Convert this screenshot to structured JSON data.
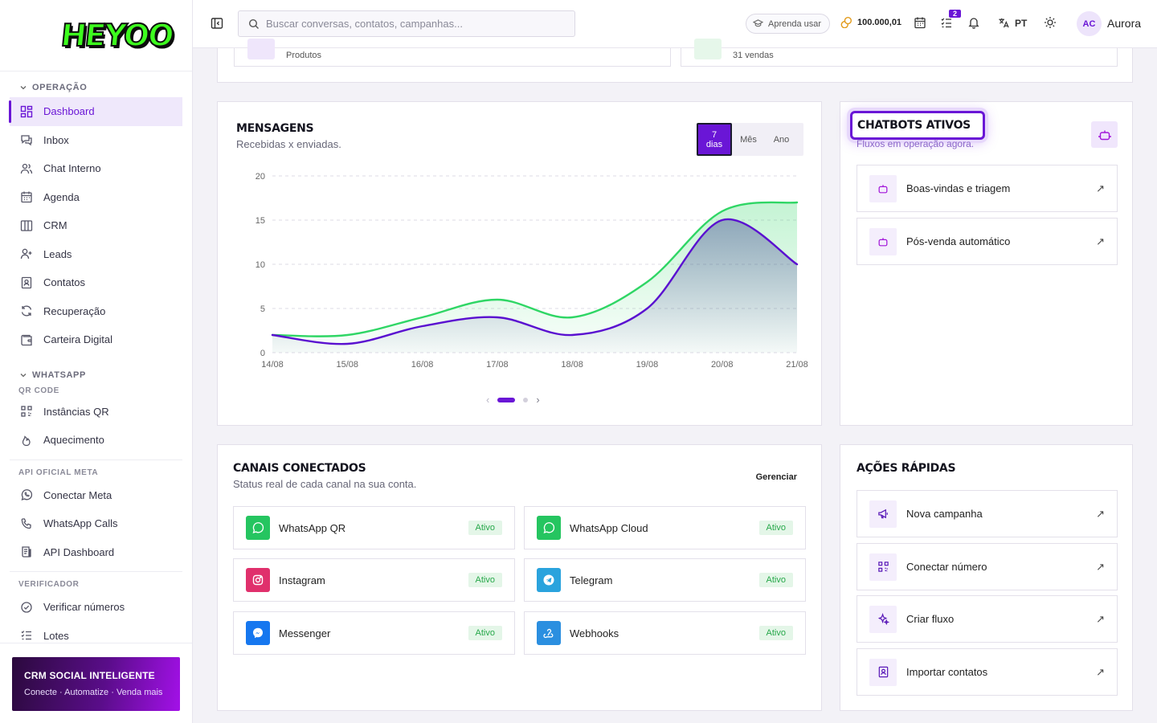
{
  "brand": {
    "logo_text": "HEYOO"
  },
  "sidebar": {
    "section_operacao": "OPERAÇÃO",
    "operacao_items": [
      {
        "label": "Dashboard",
        "icon": "dashboard-icon",
        "active": true
      },
      {
        "label": "Inbox",
        "icon": "inbox-icon"
      },
      {
        "label": "Chat Interno",
        "icon": "users-icon"
      },
      {
        "label": "Agenda",
        "icon": "calendar-icon"
      },
      {
        "label": "CRM",
        "icon": "columns-icon"
      },
      {
        "label": "Leads",
        "icon": "user-plus-icon"
      },
      {
        "label": "Contatos",
        "icon": "contact-book-icon"
      },
      {
        "label": "Recuperação",
        "icon": "refresh-icon"
      },
      {
        "label": "Carteira Digital",
        "icon": "wallet-icon"
      }
    ],
    "section_whatsapp": "WHATSAPP",
    "sub_qr": "QR CODE",
    "qr_items": [
      {
        "label": "Instâncias QR",
        "icon": "qr-icon"
      },
      {
        "label": "Aquecimento",
        "icon": "flame-icon"
      }
    ],
    "sub_meta": "API OFICIAL META",
    "meta_items": [
      {
        "label": "Conectar Meta",
        "icon": "whatsapp-icon"
      },
      {
        "label": "WhatsApp Calls",
        "icon": "phone-icon"
      },
      {
        "label": "API Dashboard",
        "icon": "document-icon"
      }
    ],
    "sub_verificador": "VERIFICADOR",
    "verif_items": [
      {
        "label": "Verificar números",
        "icon": "check-circle-icon"
      },
      {
        "label": "Lotes",
        "icon": "list-check-icon"
      }
    ],
    "promo_title": "CRM SOCIAL INTELIGENTE",
    "promo_sub": "Conecte · Automatize · Venda mais"
  },
  "topbar": {
    "search_placeholder": "Buscar conversas, contatos, campanhas...",
    "learn_label": "Aprenda usar",
    "coins": "100.000,01",
    "tasks_badge": "2",
    "lang": "PT",
    "avatar_initials": "AC",
    "user_name": "Aurora"
  },
  "top_strip": {
    "left_caption": "Produtos",
    "right_caption": "31 vendas"
  },
  "messages": {
    "title": "MENSAGENS",
    "subtitle": "Recebidas x enviadas.",
    "range_options": [
      {
        "label": "7 dias",
        "active": true
      },
      {
        "label": "Mês"
      },
      {
        "label": "Ano"
      }
    ]
  },
  "chart_data": {
    "type": "area",
    "categories": [
      "14/08",
      "15/08",
      "16/08",
      "17/08",
      "18/08",
      "19/08",
      "20/08",
      "21/08"
    ],
    "ylim": [
      0,
      20
    ],
    "yticks": [
      0,
      5,
      10,
      15,
      20
    ],
    "grid": true,
    "series": [
      {
        "values": [
          2,
          2,
          4,
          6,
          4,
          8,
          16,
          17
        ],
        "color": "#2fd665"
      },
      {
        "values": [
          2,
          1,
          3,
          4,
          2,
          5,
          15,
          10
        ],
        "color": "#5a10d0"
      }
    ],
    "carousel_page": 1,
    "carousel_pages": 2
  },
  "chatbots": {
    "title": "CHATBOTS ATIVOS",
    "subtitle": "Fluxos em operação agora.",
    "items": [
      {
        "label": "Boas-vindas e triagem"
      },
      {
        "label": "Pós-venda automático"
      }
    ]
  },
  "channels": {
    "title": "CANAIS CONECTADOS",
    "subtitle": "Status real de cada canal na sua conta.",
    "manage_label": "Gerenciar",
    "items": [
      {
        "label": "WhatsApp QR",
        "status": "Ativo",
        "color": "#25c560"
      },
      {
        "label": "WhatsApp Cloud",
        "status": "Ativo",
        "color": "#25c560"
      },
      {
        "label": "Instagram",
        "status": "Ativo",
        "color": "#e0306c"
      },
      {
        "label": "Telegram",
        "status": "Ativo",
        "color": "#2aa3dd"
      },
      {
        "label": "Messenger",
        "status": "Ativo",
        "color": "#1677ef"
      },
      {
        "label": "Webhooks",
        "status": "Ativo",
        "color": "#2b8fe0"
      }
    ]
  },
  "quick_actions": {
    "title": "AÇÕES RÁPIDAS",
    "items": [
      {
        "label": "Nova campanha"
      },
      {
        "label": "Conectar número"
      },
      {
        "label": "Criar fluxo"
      },
      {
        "label": "Importar contatos"
      }
    ]
  }
}
